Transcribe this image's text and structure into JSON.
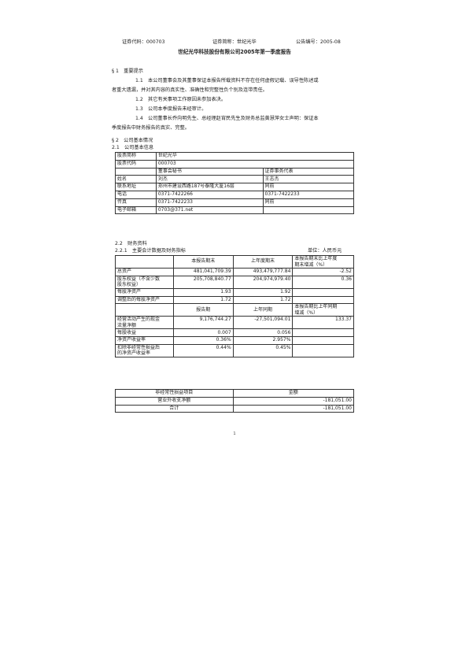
{
  "header": {
    "code": "证券代码：000703",
    "name": "证券简称：世纪光华",
    "notice": "公告编号：2005-08"
  },
  "title": "世纪光华科技股份有限公司2005年第一季度报告",
  "section1": {
    "heading": "§ 1　重要提示",
    "items": [
      "1.1　本公司董事会及其董事保证本报告所载资料不存在任何虚假记载、误导性陈述或",
      "者重大遗漏，并对其内容的真实性、准确性和完整性负个别及连带责任。",
      "1.2　其它有关事项工作原因未参加表决。",
      "1.3　公司本季度报告未经审计。",
      "1.4　公司董事长乔向明先生、总经理赵宵民先生及财务总监黄慧萍女士声明：保证本",
      "季度报告中财务报告的真实、完整。"
    ]
  },
  "section2": {
    "heading": "§ 2　公司基本情况",
    "sub1": "2.1　公司基本信息",
    "info": {
      "stock_name_label": "股票简称",
      "stock_name": "世纪光华",
      "stock_code_label": "股票代码",
      "stock_code": "000703",
      "col_secretary": "董事会秘书",
      "col_rep": "证券事务代表",
      "name_label": "姓名",
      "name_sec": "刘杰",
      "name_rep": "王志杰",
      "addr_label": "联系地址",
      "addr_sec": "郑州市建设西路187号泰隆大厦16层",
      "addr_rep": "同前",
      "phone_label": "电话",
      "phone_sec": "0371-7422266",
      "phone_rep": "0371-7422233",
      "fax_label": "传真",
      "fax_sec": "0371-7422233",
      "fax_rep": "同前",
      "email_label": "电子邮箱",
      "email_sec": "0703@371.net",
      "email_rep": ""
    },
    "sub2": "2.2　财务资料",
    "sub221": "2.2.1　主要会计数据及财务指标",
    "unit": "单位：人民币元",
    "fin": {
      "h1": "本报告期末",
      "h2": "上年度期末",
      "h3a": "本报告期末比上年度",
      "h3b": "期末增减（%）",
      "rows1": [
        {
          "label": "总资产",
          "a": "481,041,709.39",
          "b": "493,479,777.84",
          "c": "-2.52"
        },
        {
          "label": "股东权益（不含少数",
          "label2": "股东权益）",
          "a": "205,708,840.77",
          "b": "204,974,979.40",
          "c": "0.36"
        },
        {
          "label": "每股净资产",
          "a": "1.93",
          "b": "1.92",
          "c": ""
        },
        {
          "label": "调整后的每股净资产",
          "a": "1.72",
          "b": "1.72",
          "c": ""
        }
      ],
      "g1": "报告期",
      "g2": "上年同期",
      "g3a": "本报告期比上年同期",
      "g3b": "增减（%）",
      "rows2": [
        {
          "label": "经营活动产生的现金",
          "label2": "流量净额",
          "a": "9,176,744.27",
          "b": "-27,501,094.01",
          "c": "133.37"
        },
        {
          "label": "每股收益",
          "a": "0.007",
          "b": "0.056",
          "c": ""
        },
        {
          "label": "净资产收益率",
          "a": "0.36%",
          "b": "2.957%",
          "c": ""
        },
        {
          "label": "扣除非经常性损益后",
          "label2": "的净资产收益率",
          "a": "0.44%",
          "b": "0.45%",
          "c": ""
        }
      ]
    },
    "nonrec": {
      "h1": "非经常性损益项目",
      "h2": "金额",
      "r1_label": "营业外收支净额",
      "r1_val": "-181,051.00",
      "r2_label": "合计",
      "r2_val": "-181,051.00"
    }
  },
  "page_number": "1"
}
